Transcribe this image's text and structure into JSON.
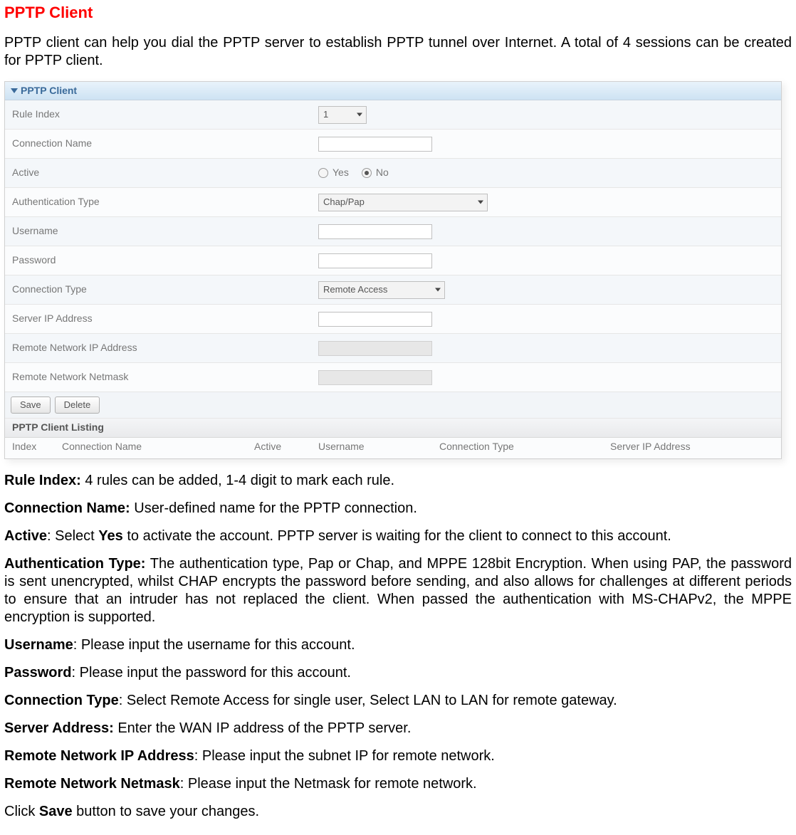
{
  "doc": {
    "title": "PPTP Client",
    "intro": "PPTP client can help you dial the PPTP server to establish PPTP tunnel over Internet. A total of 4 sessions can be created for PPTP client.",
    "p_rule_index_b": "Rule Index:",
    "p_rule_index_t": " 4 rules can be added, 1-4 digit to mark each rule.",
    "p_conn_name_b": "Connection Name:",
    "p_conn_name_t": " User-defined name for the PPTP connection.",
    "p_active_b1": "Active",
    "p_active_t1": ": Select ",
    "p_active_b2": "Yes",
    "p_active_t2": " to activate the account. PPTP server is waiting for the client to connect to this account.",
    "p_auth_b": "Authentication Type:",
    "p_auth_t": " The authentication type, Pap or Chap, and MPPE 128bit Encryption. When using PAP, the password is sent unencrypted, whilst CHAP encrypts the password before sending, and also allows for challenges at different periods to ensure that an intruder has not replaced the client. When passed the authentication with MS-CHAPv2, the MPPE encryption is supported.",
    "p_user_b": "Username",
    "p_user_t": ": Please input the username for this account.",
    "p_pass_b": "Password",
    "p_pass_t": ": Please input the password for this account.",
    "p_ctype_b": "Connection Type",
    "p_ctype_t": ": Select Remote Access for single user, Select LAN to LAN for remote gateway.",
    "p_saddr_b": "Server Address:",
    "p_saddr_t": " Enter the WAN IP address of the PPTP server.",
    "p_rnip_b": "Remote Network IP Address",
    "p_rnip_t": ": Please input the subnet IP for remote network.",
    "p_rnnm_b": "Remote Network Netmask",
    "p_rnnm_t": ": Please input the Netmask for remote network.",
    "p_save_t1": "Click ",
    "p_save_b": "Save",
    "p_save_t2": " button to save your changes."
  },
  "panel": {
    "title": "PPTP Client",
    "labels": {
      "rule_index": "Rule Index",
      "conn_name": "Connection Name",
      "active": "Active",
      "auth_type": "Authentication Type",
      "username": "Username",
      "password": "Password",
      "conn_type": "Connection Type",
      "server_ip": "Server IP Address",
      "remote_ip": "Remote Network IP Address",
      "remote_nm": "Remote Network Netmask"
    },
    "values": {
      "rule_index": "1",
      "auth_type": "Chap/Pap",
      "conn_type": "Remote Access",
      "active_yes": "Yes",
      "active_no": "No"
    },
    "buttons": {
      "save": "Save",
      "delete": "Delete"
    },
    "listing": {
      "title": "PPTP Client Listing",
      "cols": {
        "index": "Index",
        "conn_name": "Connection Name",
        "active": "Active",
        "username": "Username",
        "conn_type": "Connection Type",
        "server_ip": "Server IP Address"
      }
    }
  }
}
